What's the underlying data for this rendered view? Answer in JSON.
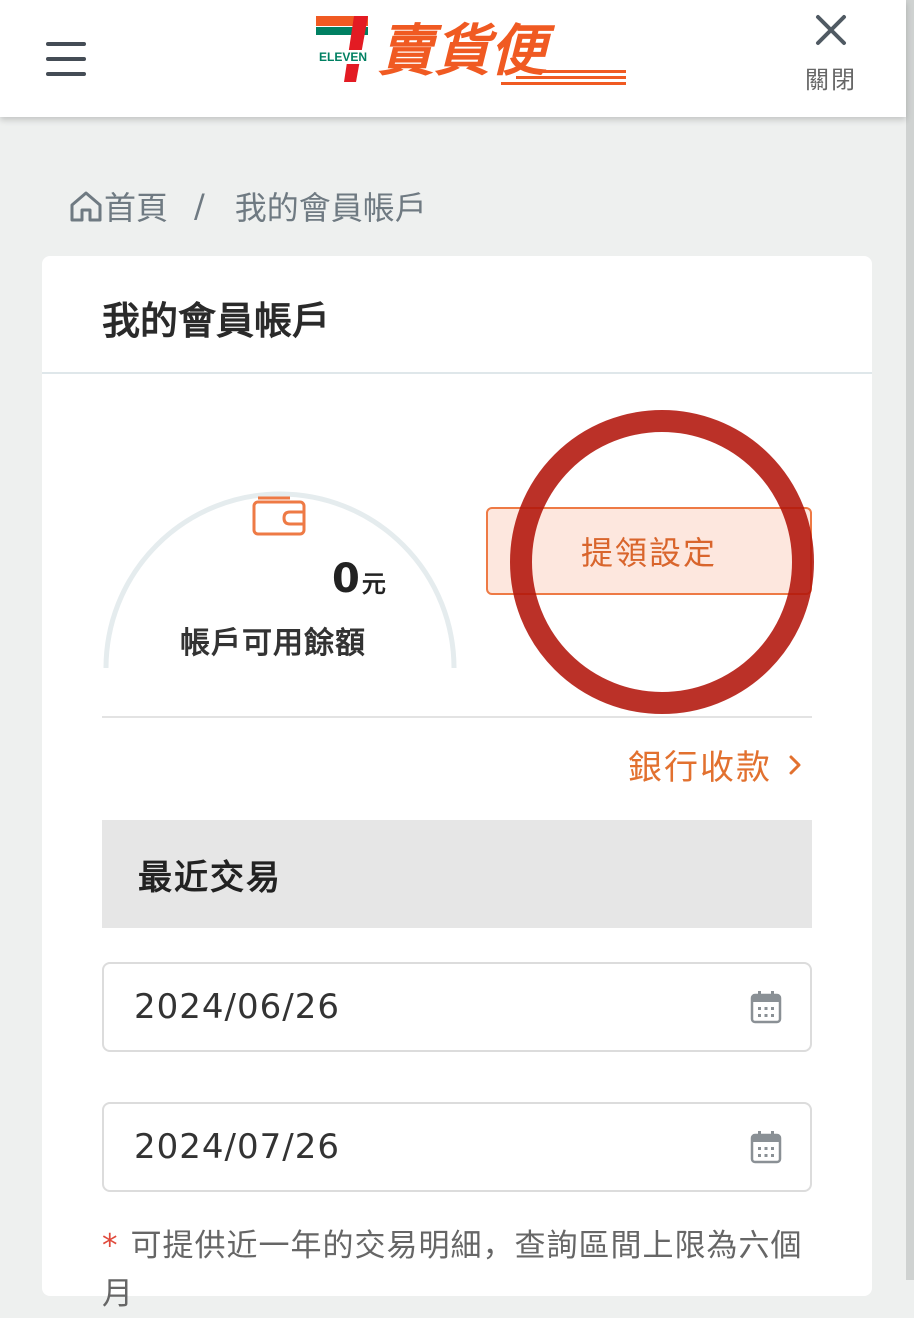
{
  "header": {
    "logo_brand": "ELEVEN",
    "logo_title": "賣貨便",
    "close_label": "關閉",
    "brand_colors": {
      "orange": "#F05A22",
      "green": "#008062",
      "red": "#E31B23"
    }
  },
  "breadcrumb": {
    "home_label": "首頁",
    "separator": "/",
    "current_label": "我的會員帳戶"
  },
  "card": {
    "title": "我的會員帳戶",
    "balance": {
      "amount": "0",
      "unit": "元",
      "label": "帳戶可用餘額"
    },
    "withdraw_button": "提領設定",
    "bank_link": "銀行收款",
    "recent_title": "最近交易",
    "date_from": "2024/06/26",
    "date_to": "2024/07/26",
    "note_mark": "*",
    "note": "可提供近一年的交易明細，查詢區間上限為六個月"
  },
  "colors": {
    "accent": "#E2712F",
    "button_bg": "#FDE7DE",
    "annotation_circle": "#B2140A"
  },
  "icons": [
    "menu-icon",
    "close-icon",
    "home-icon",
    "wallet-icon",
    "chevron-right-icon",
    "calendar-icon"
  ]
}
